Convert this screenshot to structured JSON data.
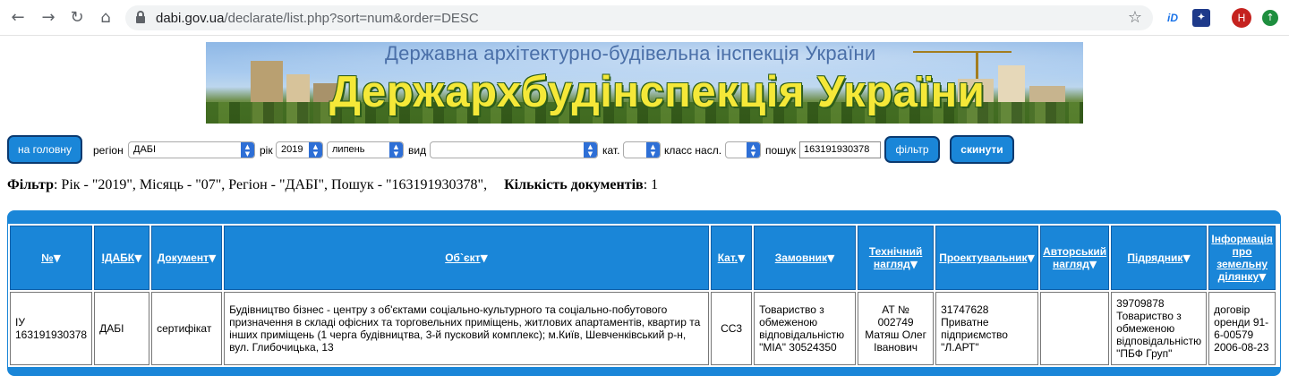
{
  "browser": {
    "url_domain": "dabi.gov.ua",
    "url_path": "/declarate/list.php?sort=num&order=DESC",
    "avatar_letter": "H"
  },
  "banner": {
    "subtitle": "Державна архітектурно-будівельна інспекція України",
    "title": "Держархбудінспекція України"
  },
  "toolbar": {
    "home_label": "на головну",
    "region_label": "регіон",
    "region_value": "ДАБІ",
    "year_label": "рік",
    "year_value": "2019",
    "month_value": "липень",
    "type_label": "вид",
    "type_value": "",
    "cat_label": "кат.",
    "cat_value": "",
    "class_label": "класс насл.",
    "class_value": "",
    "search_label": "пошук",
    "search_value": "163191930378",
    "filter_label": "фільтр",
    "reset_label": "скинути"
  },
  "filter_summary": {
    "filter_bold": "Фільтр",
    "filter_text": ": Рік - \"2019\", Місяць - \"07\", Регіон - \"ДАБІ\", Пошук - \"163191930378\",",
    "count_bold": "Кількість документів",
    "count_text": ": 1"
  },
  "table": {
    "headers": [
      "№",
      "ІДАБК",
      "Документ",
      "Об`єкт",
      "Кат.",
      "Замовник",
      "Технічний нагляд",
      "Проектувальник",
      "Авторський нагляд",
      "Підрядник",
      "Інформація про земельну ділянку"
    ],
    "sort_glyph": "▼",
    "rows": [
      {
        "num": "ІУ 163191930378",
        "idabk": "ДАБІ",
        "doc": "сертифікат",
        "object": "Будівництво бізнес - центру з об'єктами соціально-культурного та соціально-побутового призначення в складі офісних та торговельних приміщень, житлових апартаментів, квартир та інших приміщень (1 черга будівництва, 3-й пусковий комплекс); м.Київ, Шевченківський р-н, вул. Глибочицька, 13",
        "cat": "СС3",
        "customer": "Товариство з обмеженою відповідальністю \"МІА\" 30524350",
        "tech": "АТ № 002749 Матяш Олег Іванович",
        "designer": "31747628 Приватне підприємство \"Л.АРТ\"",
        "author": "",
        "contractor": "39709878 Товариство з обмеженою відповідальністю \"ПБФ Груп\"",
        "land": "договір оренди 91-6-00579 2006-08-23"
      }
    ]
  },
  "colors": {
    "accent": "#1a86d8",
    "button_border": "#0b3a70",
    "banner_title": "#f5e838"
  }
}
